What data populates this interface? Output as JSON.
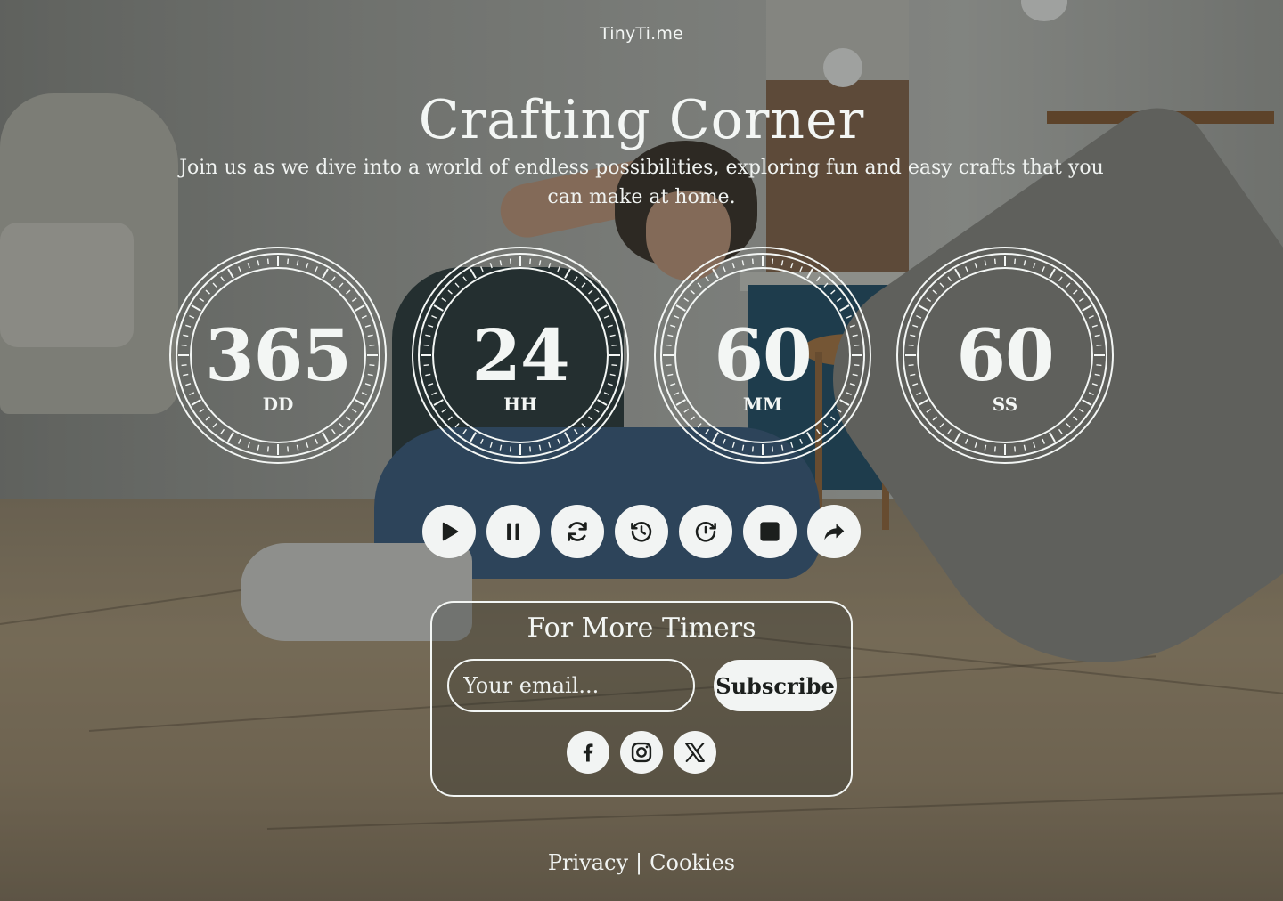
{
  "brand": "TinyTi.me",
  "header": {
    "title": "Crafting Corner",
    "subtitle": "Join us as we dive into a world of endless possibilities, exploring fun and easy crafts that you can make at home."
  },
  "timers": [
    {
      "value": "365",
      "unit": "DD"
    },
    {
      "value": "24",
      "unit": "HH"
    },
    {
      "value": "60",
      "unit": "MM"
    },
    {
      "value": "60",
      "unit": "SS"
    }
  ],
  "controls": [
    {
      "icon": "play-icon"
    },
    {
      "icon": "pause-icon"
    },
    {
      "icon": "refresh-icon"
    },
    {
      "icon": "history-icon"
    },
    {
      "icon": "restart-icon"
    },
    {
      "icon": "stop-icon"
    },
    {
      "icon": "share-icon"
    }
  ],
  "subscribe": {
    "title": "For More Timers",
    "placeholder": "Your email...",
    "button_label": "Subscribe"
  },
  "social": [
    "facebook-icon",
    "instagram-icon",
    "x-icon"
  ],
  "footer": {
    "privacy": "Privacy",
    "separator": "|",
    "cookies": "Cookies"
  },
  "colors": {
    "text": "#f3f6f4",
    "button_bg": "#f2f4f3",
    "icon": "#1c1f1d"
  }
}
